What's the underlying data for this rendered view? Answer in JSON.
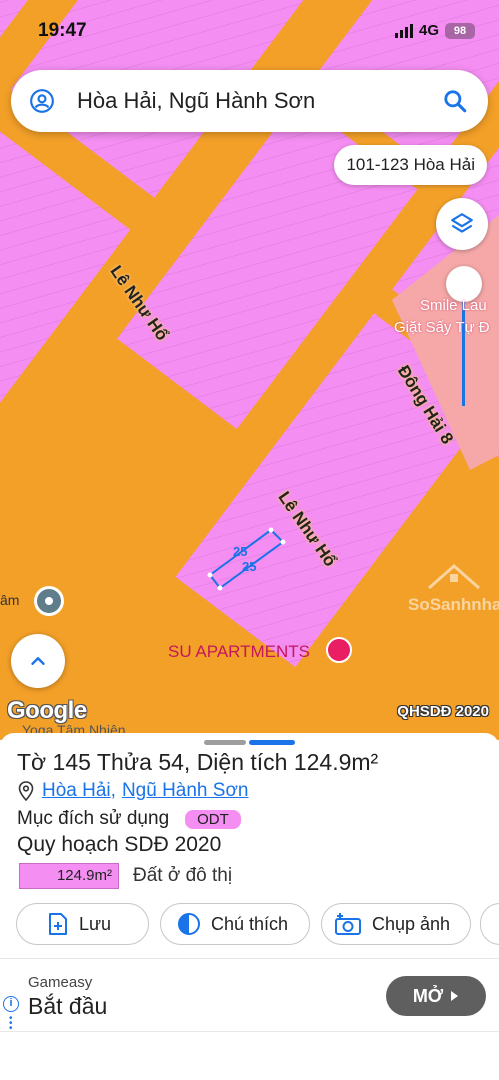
{
  "status": {
    "time": "19:47",
    "network": "4G",
    "battery": "98"
  },
  "search": {
    "query": "Hòa Hải, Ngũ Hành Sơn"
  },
  "map": {
    "address_chip": "101-123 Hòa Hải",
    "roads": [
      "Lê Như Hổ",
      "Lê Như Hổ",
      "Đông Hải 8"
    ],
    "parcel_numbers": [
      "25",
      "25"
    ],
    "pois": {
      "su": "SU APARTMENTS",
      "lam": "âm",
      "yoga": "Yoga Tâm Nhiên",
      "smile": [
        "Smile Lau",
        "Giặt Sấy Tự Đ"
      ]
    },
    "watermark": "SoSanhnha",
    "google": "Google",
    "layer_tag": "QHSDĐ 2020",
    "colors": {
      "road": "#f3a028",
      "residential": "#f48ef2",
      "commercial": "#f6a8a8",
      "highlight": "#1a73e8"
    }
  },
  "sheet": {
    "title_parts": [
      "Tờ",
      "145",
      "Thửa",
      "54,",
      "Diện tích",
      "124.9m²"
    ],
    "ward": "Hòa Hải",
    "district": "Ngũ Hành Sơn",
    "purpose_label": "Mục đích sử dụng",
    "purpose_badge": "ODT",
    "plan_title": "Quy hoạch SDĐ 2020",
    "plan_area": "124.9m²",
    "plan_desc": "Đất ở đô thị",
    "actions": [
      {
        "label": "Lưu",
        "icon": "save-icon"
      },
      {
        "label": "Chú thích",
        "icon": "legend-icon"
      },
      {
        "label": "Chụp ảnh",
        "icon": "camera-icon"
      }
    ]
  },
  "ad": {
    "brand": "Gameasy",
    "title": "Bắt đầu",
    "button": "MỞ"
  }
}
